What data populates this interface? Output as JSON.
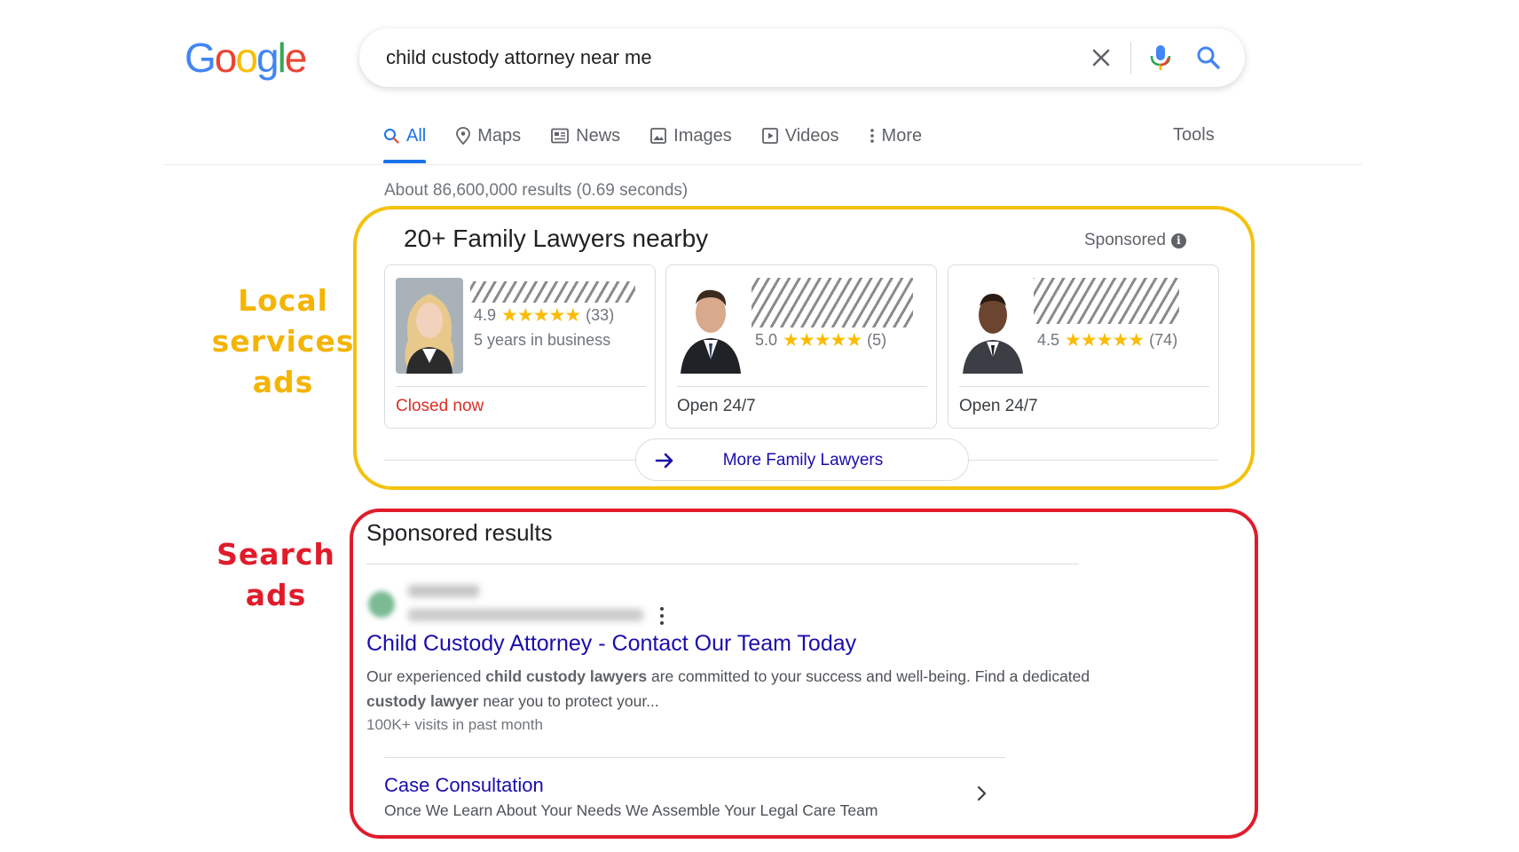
{
  "logo": {
    "letters": [
      "G",
      "o",
      "o",
      "g",
      "l",
      "e"
    ],
    "colors": [
      "#4285F4",
      "#EA4335",
      "#FBBC05",
      "#4285F4",
      "#34A853",
      "#EA4335"
    ]
  },
  "search": {
    "query": "child custody attorney near me",
    "icons": [
      "close-icon",
      "microphone-icon",
      "search-icon"
    ]
  },
  "tabs": [
    {
      "label": "All",
      "icon": "search-icon",
      "active": true
    },
    {
      "label": "Maps",
      "icon": "map-pin-icon"
    },
    {
      "label": "News",
      "icon": "news-icon"
    },
    {
      "label": "Images",
      "icon": "image-icon"
    },
    {
      "label": "Videos",
      "icon": "video-icon"
    },
    {
      "label": "More",
      "icon": "dots-vertical-icon"
    }
  ],
  "tools_label": "Tools",
  "result_stats": "About 86,600,000 results (0.69 seconds)",
  "annotations": {
    "local": "Local services ads",
    "search": "Search ads",
    "local_color": "#f4c20d",
    "search_color": "#e01c2b"
  },
  "local_services": {
    "title": "20+ Family Lawyers nearby",
    "sponsored_label": "Sponsored",
    "cards": [
      {
        "rating": "4.9",
        "stars": "★★★★★",
        "reviews": "(33)",
        "years": "5 years in business",
        "status": "Closed now",
        "status_color": "#d93025"
      },
      {
        "rating": "5.0",
        "stars": "★★★★★",
        "reviews": "(5)",
        "status": "Open 24/7"
      },
      {
        "rating": "4.5",
        "stars": "★★★★★",
        "reviews": "(74)",
        "status": "Open 24/7"
      }
    ],
    "more_label": "More Family Lawyers"
  },
  "sponsored_results": {
    "title": "Sponsored results",
    "ad": {
      "headline": "Child Custody Attorney - Contact Our Team Today",
      "desc_1": "Our experienced ",
      "desc_bold_1": "child custody lawyers",
      "desc_2": " are committed to your success and well-being. Find a dedicated ",
      "desc_bold_2": "custody lawyer",
      "desc_3": " near you to protect your...",
      "visits": "100K+ visits in past month"
    },
    "sitelink": {
      "title": "Case Consultation",
      "desc": "Once We Learn About Your Needs We Assemble Your Legal Care Team"
    }
  }
}
